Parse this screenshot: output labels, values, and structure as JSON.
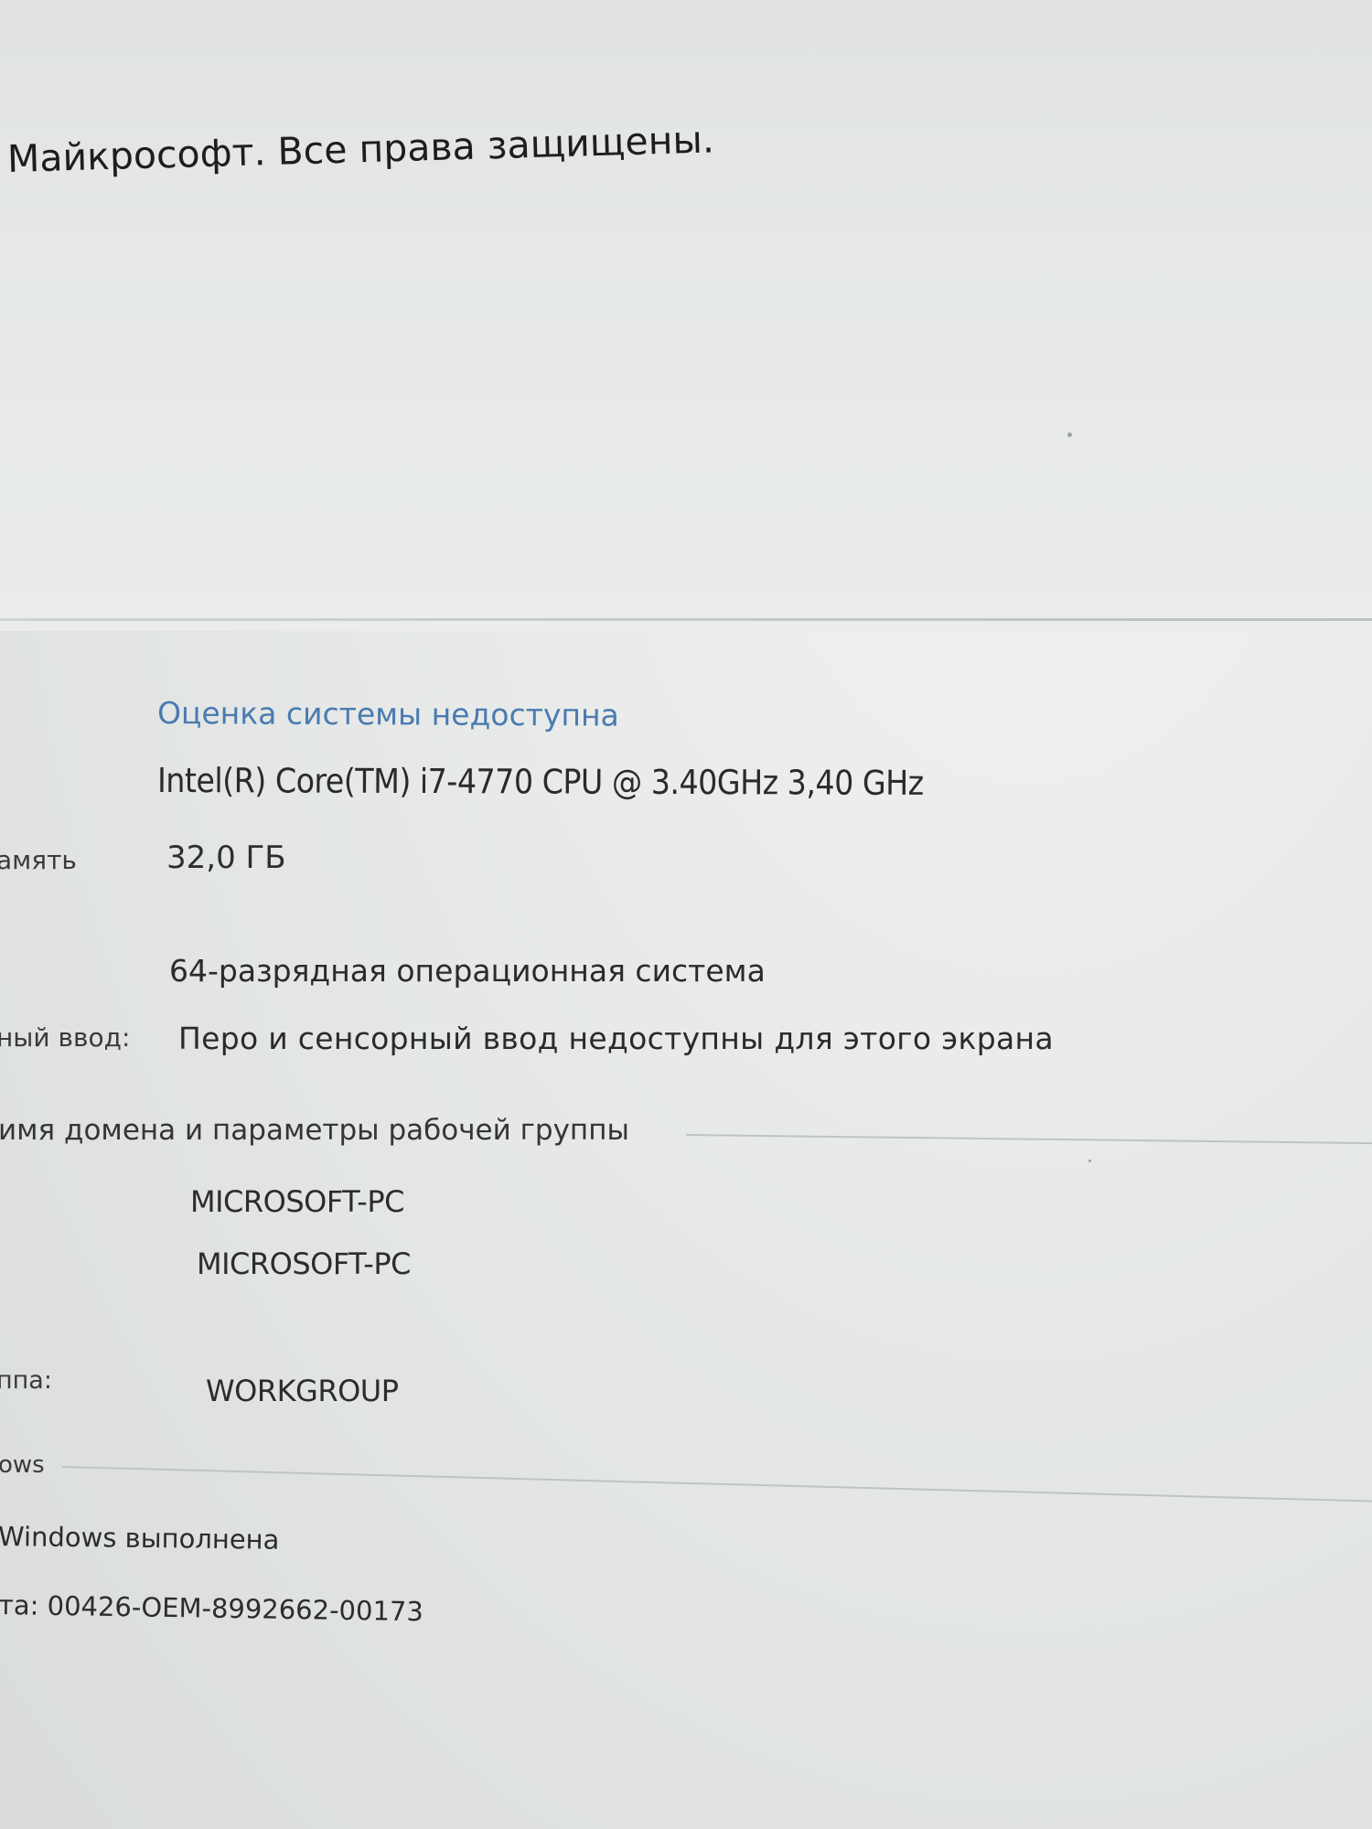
{
  "copyright_text": "Майкрософт. Все права защищены.",
  "system": {
    "rating_link": "Оценка системы недоступна",
    "processor": "Intel(R) Core(TM) i7-4770 CPU @ 3.40GHz   3,40 GHz",
    "memory_label": "амять",
    "memory_value": "32,0 ГБ",
    "system_type": "64-разрядная операционная система",
    "pen_label": "ный ввод:",
    "pen_value": "Перо и сенсорный ввод недоступны для этого экрана"
  },
  "domain": {
    "header": "имя домена и параметры рабочей группы",
    "computer_name": "MICROSOFT-PC",
    "full_name": "MICROSOFT-PC",
    "workgroup_label": "ппа:",
    "workgroup_value": "WORKGROUP"
  },
  "activation": {
    "header": "ows",
    "status": "Windows выполнена",
    "product_id": "та: 00426-OEM-8992662-00173"
  },
  "colors": {
    "link": "#4a7ab0",
    "text": "#2b2b2b",
    "background": "#e9ecea"
  }
}
